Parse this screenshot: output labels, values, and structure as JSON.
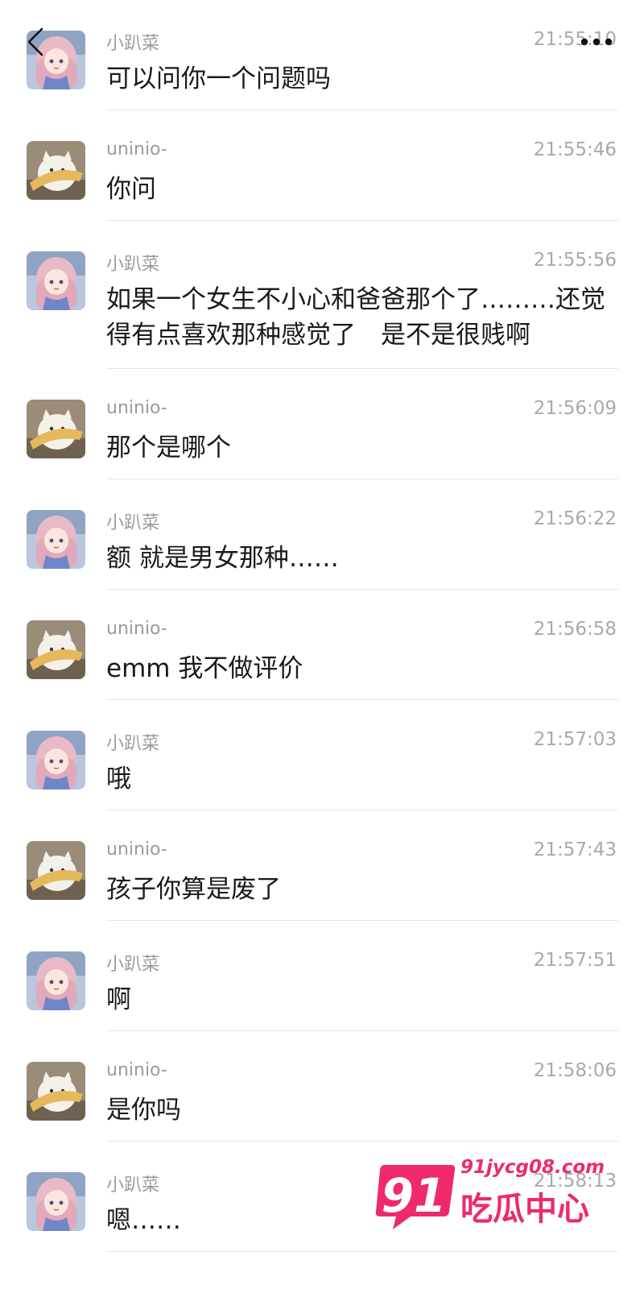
{
  "header": {
    "back_icon": "chevron-left-icon",
    "more_icon": "more-dots-icon"
  },
  "messages": [
    {
      "sender": "小趴菜",
      "avatar": "girl-avatar",
      "time": "21:55:10",
      "text": "可以问你一个问题吗"
    },
    {
      "sender": "uninio-",
      "avatar": "cat-avatar",
      "time": "21:55:46",
      "text": "你问"
    },
    {
      "sender": "小趴菜",
      "avatar": "girl-avatar",
      "time": "21:55:56",
      "text": "如果一个女生不小心和爸爸那个了………还觉得有点喜欢那种感觉了　是不是很贱啊"
    },
    {
      "sender": "uninio-",
      "avatar": "cat-avatar",
      "time": "21:56:09",
      "text": "那个是哪个"
    },
    {
      "sender": "小趴菜",
      "avatar": "girl-avatar",
      "time": "21:56:22",
      "text": "额  就是男女那种……"
    },
    {
      "sender": "uninio-",
      "avatar": "cat-avatar",
      "time": "21:56:58",
      "text": "emm 我不做评价"
    },
    {
      "sender": "小趴菜",
      "avatar": "girl-avatar",
      "time": "21:57:03",
      "text": "哦"
    },
    {
      "sender": "uninio-",
      "avatar": "cat-avatar",
      "time": "21:57:43",
      "text": "孩子你算是废了"
    },
    {
      "sender": "小趴菜",
      "avatar": "girl-avatar",
      "time": "21:57:51",
      "text": "啊"
    },
    {
      "sender": "uninio-",
      "avatar": "cat-avatar",
      "time": "21:58:06",
      "text": "是你吗"
    },
    {
      "sender": "小趴菜",
      "avatar": "girl-avatar",
      "time": "21:58:13",
      "text": "嗯……"
    }
  ],
  "watermark": {
    "badge": "91",
    "url": "91jycg08.com",
    "title": "吃瓜中心",
    "color": "#ee2a6d"
  }
}
